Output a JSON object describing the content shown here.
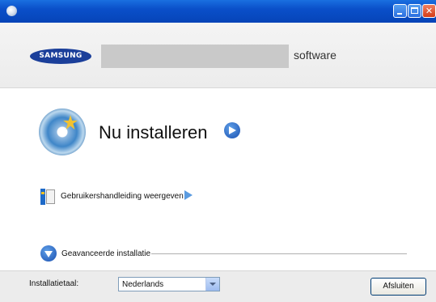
{
  "window": {
    "title": ""
  },
  "header": {
    "brand": "SAMSUNG",
    "suffix": "software"
  },
  "main": {
    "install_now": "Nu installeren",
    "user_guide_link": "Gebruikershandleiding weergeven",
    "advanced_install": "Geavanceerde installatie"
  },
  "footer": {
    "language_label": "Installatietaal:",
    "language_value": "Nederlands",
    "exit_button": "Afsluiten"
  },
  "icons": {
    "window_icon": "app-icon",
    "install": "cd-star-icon",
    "install_arrow": "arrow-right-circle-icon",
    "guide": "manual-book-icon",
    "guide_arrow": "play-triangle-icon",
    "advanced": "arrow-down-circle-icon"
  },
  "colors": {
    "titlebar": "#0a4fc9",
    "brand": "#1b3f9a"
  }
}
